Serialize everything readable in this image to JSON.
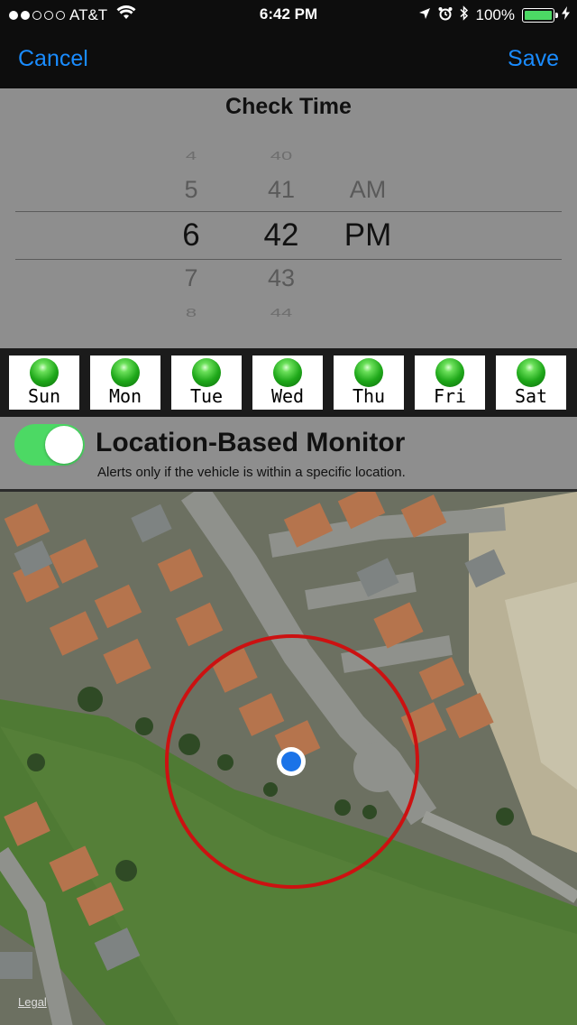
{
  "status_bar": {
    "carrier": "AT&T",
    "time": "6:42 PM",
    "battery": "100%",
    "signal_bars": 2
  },
  "nav": {
    "cancel_label": "Cancel",
    "save_label": "Save",
    "accent_color": "#1a8cff"
  },
  "time_picker": {
    "title": "Check Time",
    "hours": [
      "4",
      "5",
      "6",
      "7",
      "8"
    ],
    "minutes": [
      "40",
      "41",
      "42",
      "43",
      "44"
    ],
    "ampm": [
      "AM",
      "PM"
    ],
    "selected": {
      "hour": "6",
      "minute": "42",
      "ampm": "PM"
    }
  },
  "days": [
    {
      "label": "Sun",
      "enabled": true
    },
    {
      "label": "Mon",
      "enabled": true
    },
    {
      "label": "Tue",
      "enabled": true
    },
    {
      "label": "Wed",
      "enabled": true
    },
    {
      "label": "Thu",
      "enabled": true
    },
    {
      "label": "Fri",
      "enabled": true
    },
    {
      "label": "Sat",
      "enabled": true
    }
  ],
  "location_monitor": {
    "title": "Location-Based Monitor",
    "subtitle": "Alerts only if the vehicle is within a specific location.",
    "enabled": true,
    "toggle_color": "#4cd964"
  },
  "map": {
    "legal_label": "Legal",
    "geofence_color": "#cc1111",
    "pin_color": "#1a73e8"
  }
}
